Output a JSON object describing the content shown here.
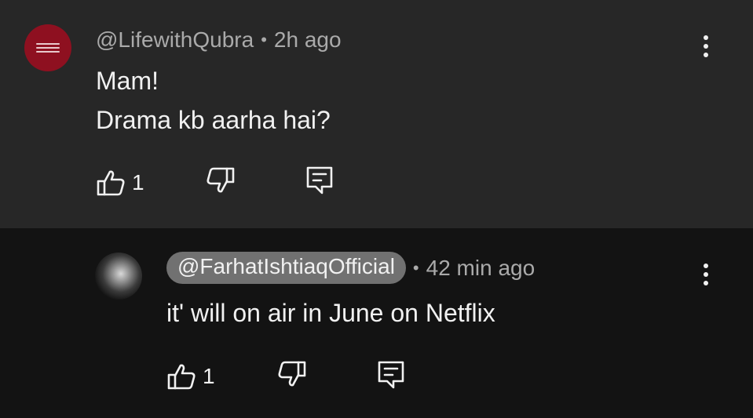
{
  "comment": {
    "handle": "@LifewithQubra",
    "separator": "•",
    "time": "2h ago",
    "lines": [
      "Mam!",
      "Drama kb aarha hai?"
    ],
    "like_count": "1",
    "avatar_color": "#8e1020"
  },
  "reply": {
    "handle": "@FarhatIshtiaqOfficial",
    "separator": "•",
    "time": "42 min ago",
    "text": "it' will on air in June on Netflix",
    "like_count": "1"
  },
  "icons": [
    "like-icon",
    "dislike-icon",
    "reply-icon",
    "more-vert-icon"
  ],
  "colors": {
    "top_background": "#272727",
    "reply_background": "#131313",
    "secondary_text": "#aaaaaa",
    "primary_text": "#f1f1f1",
    "creator_pill": "#717171"
  }
}
